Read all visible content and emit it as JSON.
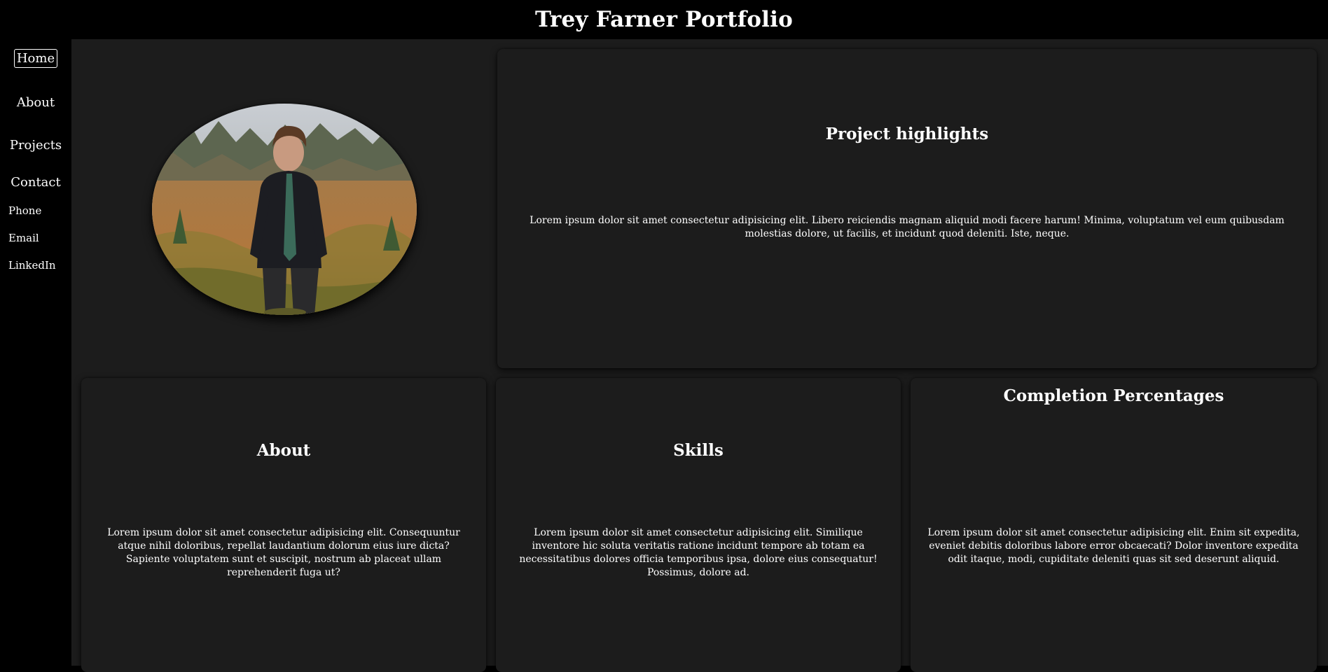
{
  "header": {
    "title": "Trey Farner Portfolio"
  },
  "sidebar": {
    "nav": [
      {
        "label": "Home",
        "active": true
      },
      {
        "label": "About",
        "active": false
      },
      {
        "label": "Projects",
        "active": false
      },
      {
        "label": "Contact",
        "active": false
      }
    ],
    "contact_links": [
      "Phone",
      "Email",
      "LinkedIn"
    ]
  },
  "cards": {
    "project_highlights": {
      "title": "Project highlights",
      "body": "Lorem ipsum dolor sit amet consectetur adipisicing elit. Libero reiciendis magnam aliquid modi facere harum! Minima, voluptatum vel eum quibusdam molestias dolore, ut facilis, et incidunt quod deleniti. Iste, neque."
    },
    "about": {
      "title": "About",
      "body": "Lorem ipsum dolor sit amet consectetur adipisicing elit. Consequuntur atque nihil doloribus, repellat laudantium dolorum eius iure dicta? Sapiente voluptatem sunt et suscipit, nostrum ab placeat ullam reprehenderit fuga ut?"
    },
    "skills": {
      "title": "Skills",
      "body": "Lorem ipsum dolor sit amet consectetur adipisicing elit. Similique inventore hic soluta veritatis ratione incidunt tempore ab totam ea necessitatibus dolores officia temporibus ipsa, dolore eius consequatur! Possimus, dolore ad."
    },
    "completion": {
      "title": "Completion Percentages",
      "body": "Lorem ipsum dolor sit amet consectetur adipisicing elit. Enim sit expedita, eveniet debitis doloribus labore error obcaecati? Dolor inventore expedita odit itaque, modi, cupiditate deleniti quas sit sed deserunt aliquid."
    }
  },
  "colors": {
    "page_bg": "#000000",
    "content_bg": "#1c1c1c",
    "text": "#ffffff"
  }
}
